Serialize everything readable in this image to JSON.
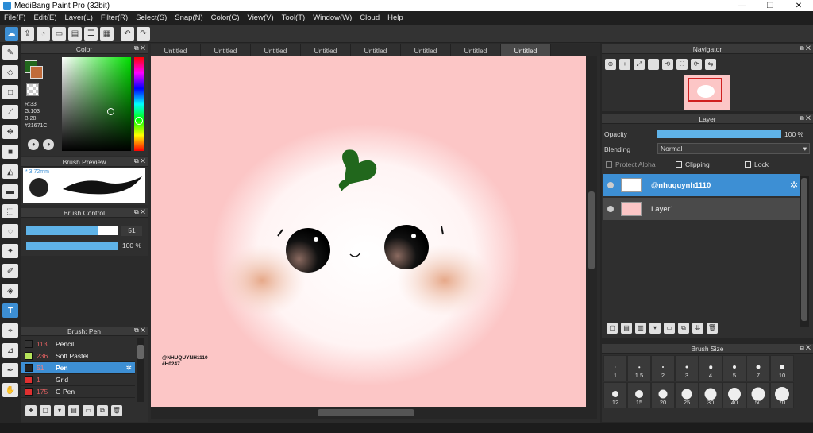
{
  "window": {
    "title": "MediBang Paint Pro (32bit)",
    "min": "—",
    "max": "❐",
    "close": "✕"
  },
  "menu": [
    "File(F)",
    "Edit(E)",
    "Layer(L)",
    "Filter(R)",
    "Select(S)",
    "Snap(N)",
    "Color(C)",
    "View(V)",
    "Tool(T)",
    "Window(W)",
    "Cloud",
    "Help"
  ],
  "tabs": [
    "Untitled",
    "Untitled",
    "Untitled",
    "Untitled",
    "Untitled",
    "Untitled",
    "Untitled",
    "Untitled"
  ],
  "color_panel": {
    "title": "Color",
    "r": "R:33",
    "g": "G:103",
    "b": "B:28",
    "hex": "#21671C",
    "main_color": "#21671c",
    "sub_color": "#c06b3a"
  },
  "brush_preview": {
    "title": "Brush Preview",
    "size": "3.72mm"
  },
  "brush_control": {
    "title": "Brush Control",
    "size_value": "51",
    "opacity_value": "100 %",
    "size_fill": 0.78,
    "opacity_fill": 1.0
  },
  "brush_list": {
    "title": "Brush: Pen",
    "items": [
      {
        "num": "113",
        "name": "Pencil",
        "color": "#333333"
      },
      {
        "num": "236",
        "name": "Soft Pastel",
        "color": "#b5e35a"
      },
      {
        "num": "51",
        "name": "Pen",
        "color": "#222222"
      },
      {
        "num": "1",
        "name": "Grid",
        "color": "#e03030"
      },
      {
        "num": "175",
        "name": "G Pen",
        "color": "#e03030"
      }
    ]
  },
  "navigator": {
    "title": "Navigator"
  },
  "layer_panel": {
    "title": "Layer",
    "opacity_label": "Opacity",
    "opacity_value": "100 %",
    "blending_label": "Blending",
    "blending_value": "Normal",
    "protect_alpha": "Protect Alpha",
    "clipping": "Clipping",
    "lock": "Lock",
    "layers": [
      {
        "name": "@nhuquynh1110"
      },
      {
        "name": "Layer1"
      }
    ]
  },
  "brush_size": {
    "title": "Brush Size",
    "sizes": [
      "1",
      "1.5",
      "2",
      "3",
      "4",
      "5",
      "7",
      "10",
      "12",
      "15",
      "20",
      "25",
      "30",
      "40",
      "50",
      "70"
    ]
  },
  "canvas": {
    "signature": "@NHUQUYNH1110",
    "signature2": "#H0247"
  }
}
